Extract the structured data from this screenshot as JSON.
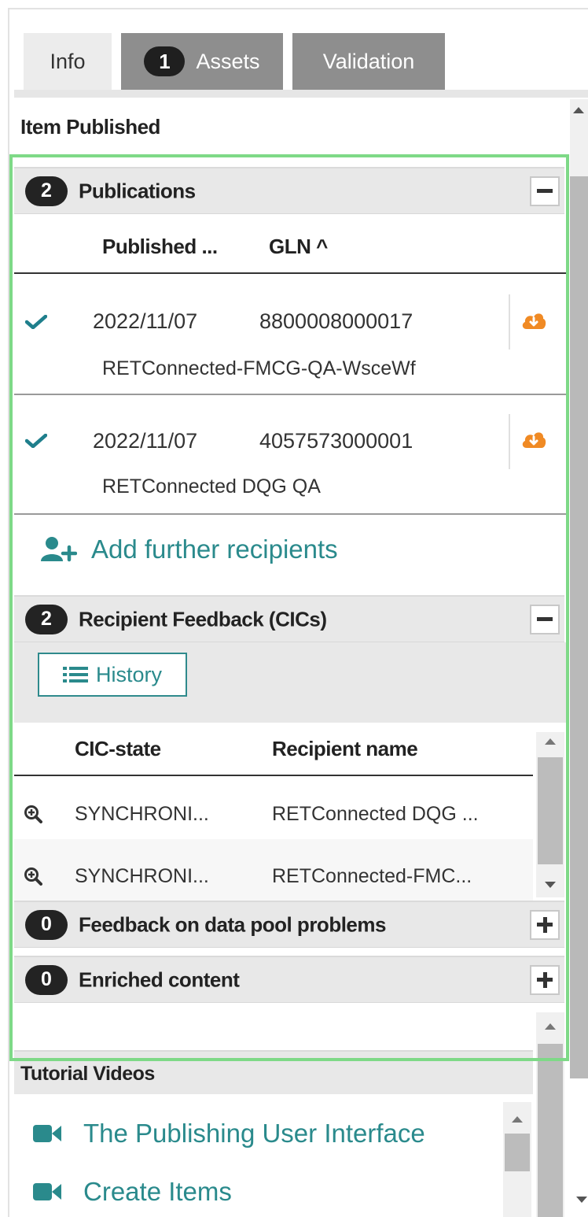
{
  "tabs": [
    {
      "label": "Info",
      "active": true
    },
    {
      "label": "Assets",
      "badge": "1"
    },
    {
      "label": "Validation"
    }
  ],
  "status_title": "Item Published",
  "publications": {
    "count": "2",
    "title": "Publications",
    "columns": [
      "Published ...",
      "GLN ^"
    ],
    "rows": [
      {
        "date": "2022/11/07",
        "gln": "8800008000017",
        "recipient": "RETConnected-FMCG-QA-WsceWf"
      },
      {
        "date": "2022/11/07",
        "gln": "4057573000001",
        "recipient": "RETConnected DQG QA"
      }
    ],
    "add_recipients_label": "Add further recipients"
  },
  "feedback": {
    "count": "2",
    "title": "Recipient Feedback (CICs)",
    "history_label": "History",
    "columns": [
      "CIC-state",
      "Recipient name"
    ],
    "rows": [
      {
        "state": "SYNCHRONI...",
        "recipient": "RETConnected DQG ..."
      },
      {
        "state": "SYNCHRONI...",
        "recipient": "RETConnected-FMC..."
      }
    ]
  },
  "data_pool_problems": {
    "count": "0",
    "title": "Feedback on data pool problems"
  },
  "enriched_content": {
    "count": "0",
    "title": "Enriched content"
  },
  "tutorial": {
    "title": "Tutorial Videos",
    "videos": [
      "The Publishing User Interface",
      "Create Items"
    ]
  },
  "colors": {
    "accent_teal": "#2a8a8c",
    "cloud_orange": "#f08a24",
    "highlight_green": "#7ed987",
    "badge_dark": "#232323"
  },
  "icons": {
    "check": "check-icon",
    "cloud": "cloud-download-icon",
    "add_user": "add-user-icon",
    "list": "list-icon",
    "zoom": "zoom-in-icon",
    "video": "video-camera-icon"
  }
}
